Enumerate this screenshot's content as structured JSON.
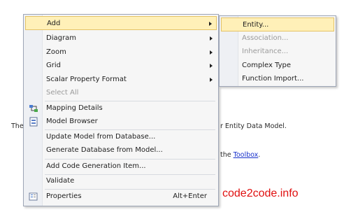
{
  "background": {
    "line1_left": "The",
    "line1_right": "r Entity Data Model.",
    "line2_prefix": "the",
    "line2_link": "Toolbox",
    "line2_suffix": "."
  },
  "watermark": "code2code.info",
  "context_menu": {
    "items": [
      {
        "label": "Add",
        "submenu": true
      },
      {
        "label": "Diagram",
        "submenu": true
      },
      {
        "label": "Zoom",
        "submenu": true
      },
      {
        "label": "Grid",
        "submenu": true
      },
      {
        "label": "Scalar Property Format",
        "submenu": true
      },
      {
        "label": "Select All",
        "disabled": true
      },
      {
        "label": "Mapping Details",
        "icon": "mapping-details-icon"
      },
      {
        "label": "Model Browser",
        "icon": "model-browser-icon"
      },
      {
        "label": "Update Model from Database..."
      },
      {
        "label": "Generate Database from Model..."
      },
      {
        "label": "Add Code Generation Item..."
      },
      {
        "label": "Validate"
      },
      {
        "label": "Properties",
        "shortcut": "Alt+Enter",
        "icon": "properties-icon"
      }
    ]
  },
  "add_submenu": {
    "items": [
      {
        "label": "Entity..."
      },
      {
        "label": "Association...",
        "disabled": true
      },
      {
        "label": "Inheritance...",
        "disabled": true
      },
      {
        "label": "Complex Type"
      },
      {
        "label": "Function Import..."
      }
    ]
  },
  "colors": {
    "highlight": "#fff0b8",
    "watermark": "#e01010",
    "link": "#1a33cc"
  }
}
